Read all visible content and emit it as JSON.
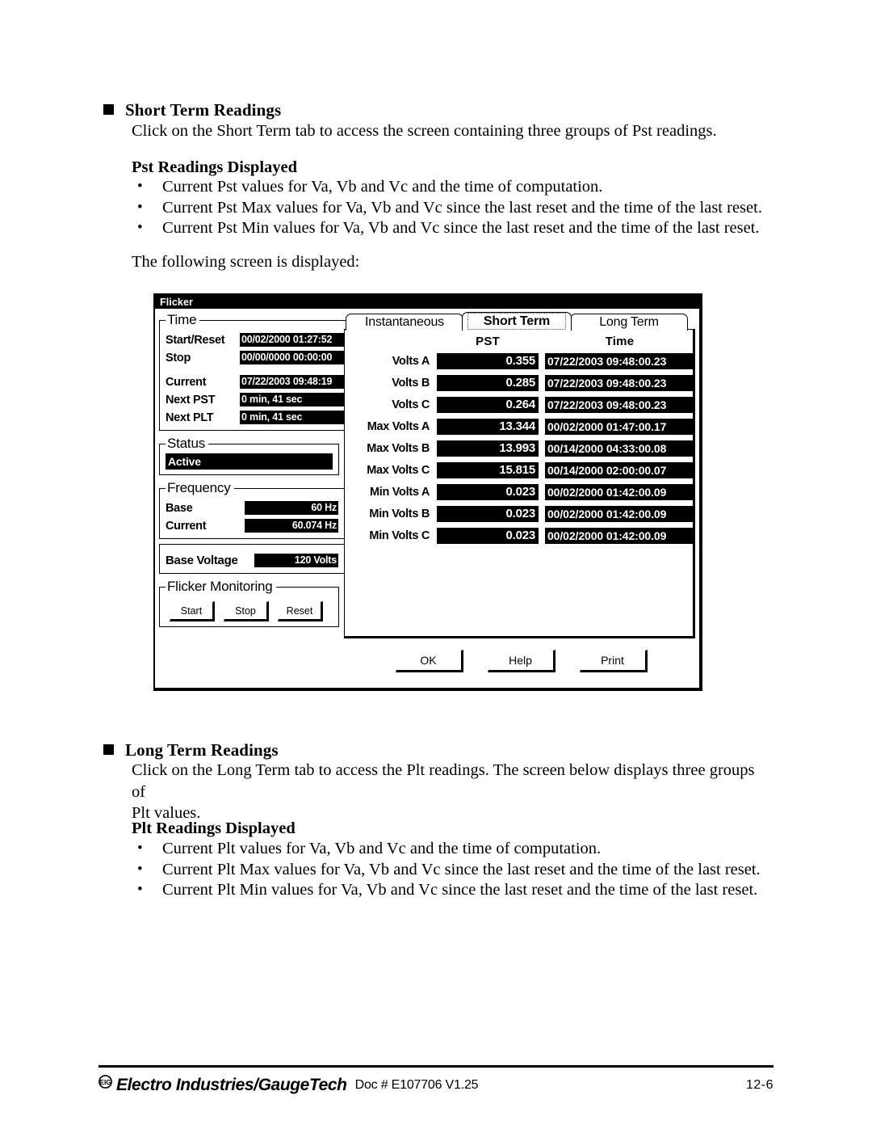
{
  "document": {
    "section1": {
      "title": "Short Term Readings",
      "intro": "Click on the Short Term tab to access the screen containing three groups of Pst readings.",
      "subhead": "Pst Readings Displayed",
      "bullets": [
        "Current Pst values for Va, Vb and Vc and the time of computation.",
        "Current Pst Max values for Va, Vb and Vc since the last reset and the time of the last reset.",
        "Current Pst Min values for Va, Vb and Vc since the last reset and the time of the last reset."
      ],
      "caption": "The following screen is displayed:"
    },
    "section2": {
      "title": "Long Term Readings",
      "intro": "Click on the Long Term tab to access the Plt readings.  The screen below displays three groups of\nPlt values.",
      "subhead": "Plt Readings Displayed",
      "bullets": [
        "Current Plt values for Va, Vb and Vc and the time of computation.",
        "Current Plt Max values for Va, Vb and Vc since the last reset and the time of the last reset.",
        "Current Plt Min values for Va, Vb and Vc since the last reset and the time of the last reset."
      ]
    },
    "footer": {
      "logo_mark": "EIG",
      "brand": "Electro Industries/GaugeTech",
      "doc": "Doc # E107706   V1.25",
      "page": "12-6"
    }
  },
  "dialog": {
    "title": "Flicker",
    "time_group": {
      "legend": "Time",
      "rows": [
        {
          "label": "Start/Reset",
          "value": "00/02/2000 01:27:52"
        },
        {
          "label": "Stop",
          "value": "00/00/0000 00:00:00"
        },
        {
          "label": "Current",
          "value": "07/22/2003 09:48:19"
        },
        {
          "label": "Next PST",
          "value": "0 min, 41 sec"
        },
        {
          "label": "Next PLT",
          "value": "0 min, 41 sec"
        }
      ]
    },
    "status_group": {
      "legend": "Status",
      "value": "Active"
    },
    "frequency_group": {
      "legend": "Frequency",
      "rows": [
        {
          "label": "Base",
          "value": "60 Hz"
        },
        {
          "label": "Current",
          "value": "60.074 Hz"
        }
      ]
    },
    "base_voltage_group": {
      "label": "Base Voltage",
      "value": "120 Volts"
    },
    "monitoring_group": {
      "legend": "Flicker Monitoring",
      "buttons": [
        "Start",
        "Stop",
        "Reset"
      ]
    },
    "tabs": [
      {
        "label": "Instantaneous",
        "selected": false
      },
      {
        "label": "Short Term",
        "selected": true
      },
      {
        "label": "Long Term",
        "selected": false
      }
    ],
    "table": {
      "columns": [
        "",
        "PST",
        "Time"
      ],
      "rows": [
        {
          "label": "Volts A",
          "pst": "0.355",
          "time": "07/22/2003 09:48:00.23"
        },
        {
          "label": "Volts B",
          "pst": "0.285",
          "time": "07/22/2003 09:48:00.23"
        },
        {
          "label": "Volts C",
          "pst": "0.264",
          "time": "07/22/2003 09:48:00.23"
        },
        {
          "label": "Max Volts A",
          "pst": "13.344",
          "time": "00/02/2000 01:47:00.17"
        },
        {
          "label": "Max Volts B",
          "pst": "13.993",
          "time": "00/14/2000 04:33:00.08"
        },
        {
          "label": "Max Volts C",
          "pst": "15.815",
          "time": "00/14/2000 02:00:00.07"
        },
        {
          "label": "Min Volts A",
          "pst": "0.023",
          "time": "00/02/2000 01:42:00.09"
        },
        {
          "label": "Min Volts B",
          "pst": "0.023",
          "time": "00/02/2000 01:42:00.09"
        },
        {
          "label": "Min Volts C",
          "pst": "0.023",
          "time": "00/02/2000 01:42:00.09"
        }
      ]
    },
    "actions": [
      "OK",
      "Help",
      "Print"
    ]
  }
}
